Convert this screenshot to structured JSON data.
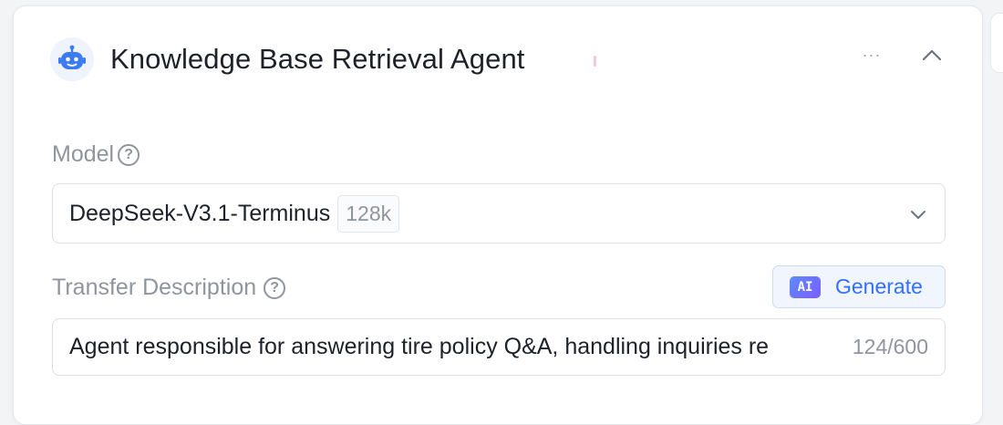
{
  "agent": {
    "title": "Knowledge Base Retrieval Agent",
    "more_label": "···"
  },
  "model_field": {
    "label": "Model",
    "selected_model": "DeepSeek-V3.1-Terminus",
    "context_badge": "128k"
  },
  "description_field": {
    "label": "Transfer Description",
    "generate_badge": "AI",
    "generate_label": "Generate",
    "value": "Agent responsible for answering tire policy Q&A, handling inquiries re",
    "char_count": "124/600"
  },
  "icons": {
    "avatar": "robot-icon",
    "more": "more-horizontal-icon",
    "collapse": "chevron-up-icon",
    "help": "question-circle-icon",
    "select": "chevron-down-icon"
  },
  "colors": {
    "accent": "#3370ff",
    "text_primary": "#1d2129",
    "text_secondary": "#8f959e",
    "avatar_blue": "#3b7cf5"
  }
}
